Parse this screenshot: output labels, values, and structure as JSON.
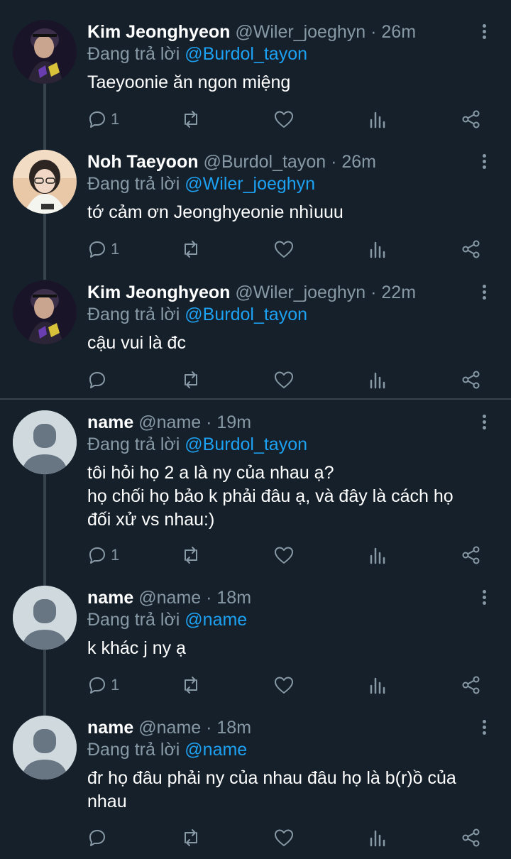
{
  "colors": {
    "background": "#15202b",
    "secondary_text": "#8899a6",
    "mention": "#1da1f2",
    "divider": "#38444d"
  },
  "tweets": [
    {
      "display_name": "Kim Jeonghyeon",
      "meta": "@Wiler_joeghyn · 26m",
      "reply_prefix": "Đang trả lời",
      "reply_to": "@Burdol_tayon",
      "text": "Taeyoonie ăn ngon miệng",
      "reply_count": "1",
      "avatar": "photo-dark"
    },
    {
      "display_name": "Noh Taeyoon",
      "meta": "@Burdol_tayon · 26m",
      "reply_prefix": "Đang trả lời",
      "reply_to": "@Wiler_joeghyn",
      "text": "tớ cảm ơn Jeonghyeonie nhìuuu",
      "reply_count": "1",
      "avatar": "photo-light"
    },
    {
      "display_name": "Kim Jeonghyeon",
      "meta": "@Wiler_joeghyn · 22m",
      "reply_prefix": "Đang trả lời",
      "reply_to": "@Burdol_tayon",
      "text": "cậu vui là đc",
      "reply_count": "",
      "avatar": "photo-dark"
    },
    {
      "display_name": "name",
      "meta": "@name · 19m",
      "reply_prefix": "Đang trả lời",
      "reply_to": "@Burdol_tayon",
      "text_lines": [
        "tôi hỏi họ 2 a là ny của nhau ạ?",
        "họ chối họ bảo k phải đâu ạ, và đây là cách họ",
        "đối xử vs nhau:)"
      ],
      "reply_count": "1",
      "avatar": "placeholder"
    },
    {
      "display_name": "name",
      "meta": "@name · 18m",
      "reply_prefix": "Đang trả lời",
      "reply_to": "@name",
      "text": "k khác j ny ạ",
      "reply_count": "1",
      "avatar": "placeholder"
    },
    {
      "display_name": "name",
      "meta": "@name · 18m",
      "reply_prefix": "Đang trả lời",
      "reply_to": "@name",
      "text_lines": [
        "đr họ đâu phải ny của nhau đâu họ là b(r)ồ của",
        "nhau"
      ],
      "reply_count": "",
      "avatar": "placeholder"
    }
  ]
}
